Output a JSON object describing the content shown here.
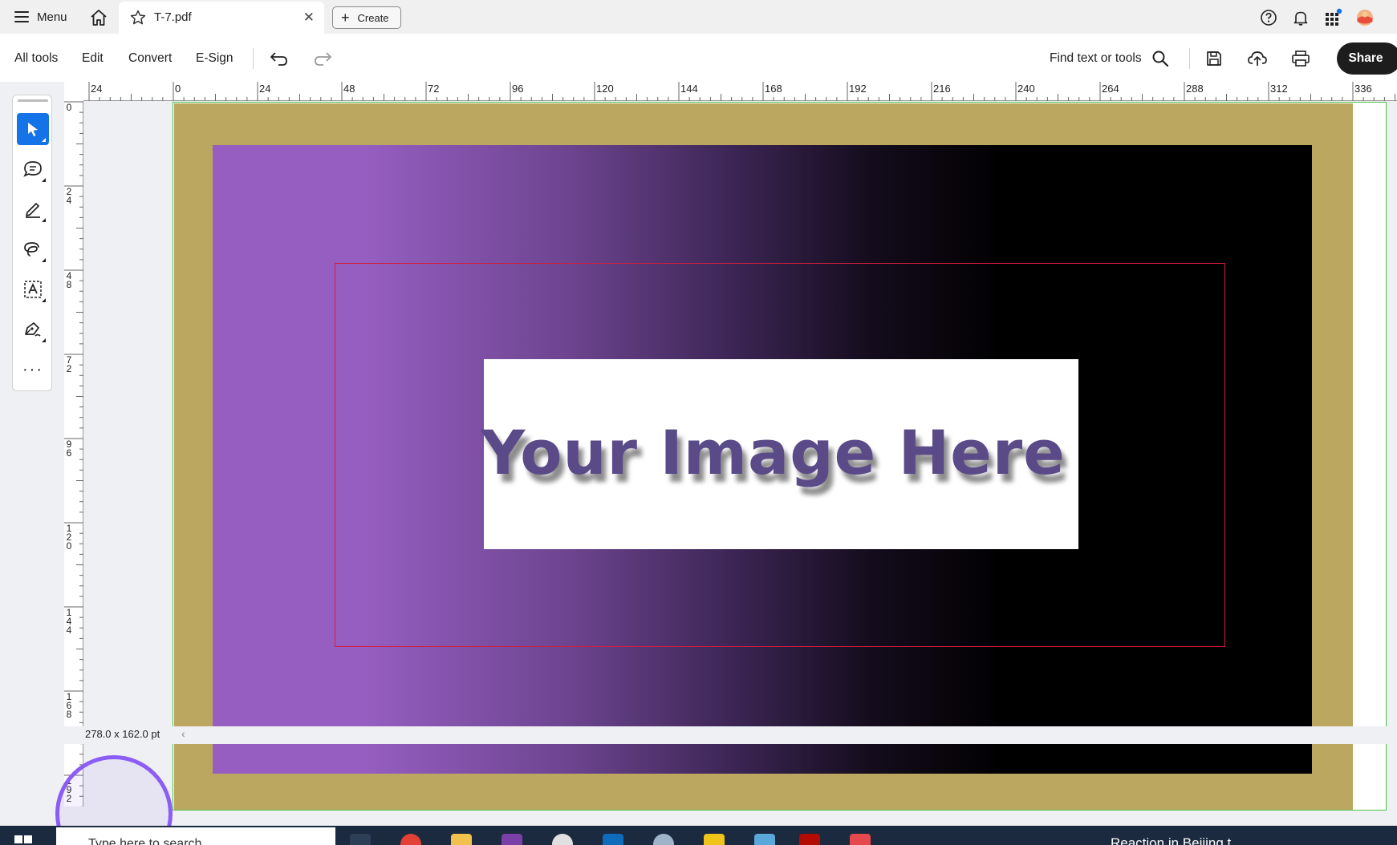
{
  "tabbar": {
    "menu_label": "Menu",
    "doc_tab_title": "T-7.pdf",
    "create_label": "Create"
  },
  "toolbar": {
    "items": [
      "All tools",
      "Edit",
      "Convert",
      "E-Sign"
    ],
    "find_placeholder": "Find text or tools",
    "share_label": "Share"
  },
  "tools": [
    "select-tool",
    "comment-tool",
    "highlight-tool",
    "draw-tool",
    "text-tool",
    "sign-tool",
    "more-tools"
  ],
  "rulers": {
    "horizontal": [
      "24",
      "0",
      "24",
      "48",
      "72",
      "96",
      "120",
      "144",
      "168",
      "192",
      "216",
      "240",
      "264",
      "288",
      "312",
      "336"
    ],
    "vertical": [
      "0",
      "24",
      "48",
      "72",
      "96",
      "120",
      "144",
      "168",
      "192"
    ]
  },
  "page": {
    "placeholder_text": "Your Image Here",
    "colors": {
      "border_gold": "#bba75f",
      "gradient_start": "#955ec0",
      "gradient_end": "#000000",
      "red_box": "#d41c3c",
      "page_outline": "#4cc24c"
    }
  },
  "status": {
    "dimensions": "278.0 x 162.0 pt"
  },
  "taskbar": {
    "search_placeholder": "Type here to search",
    "news_text": "Reaction in Beijing t"
  }
}
